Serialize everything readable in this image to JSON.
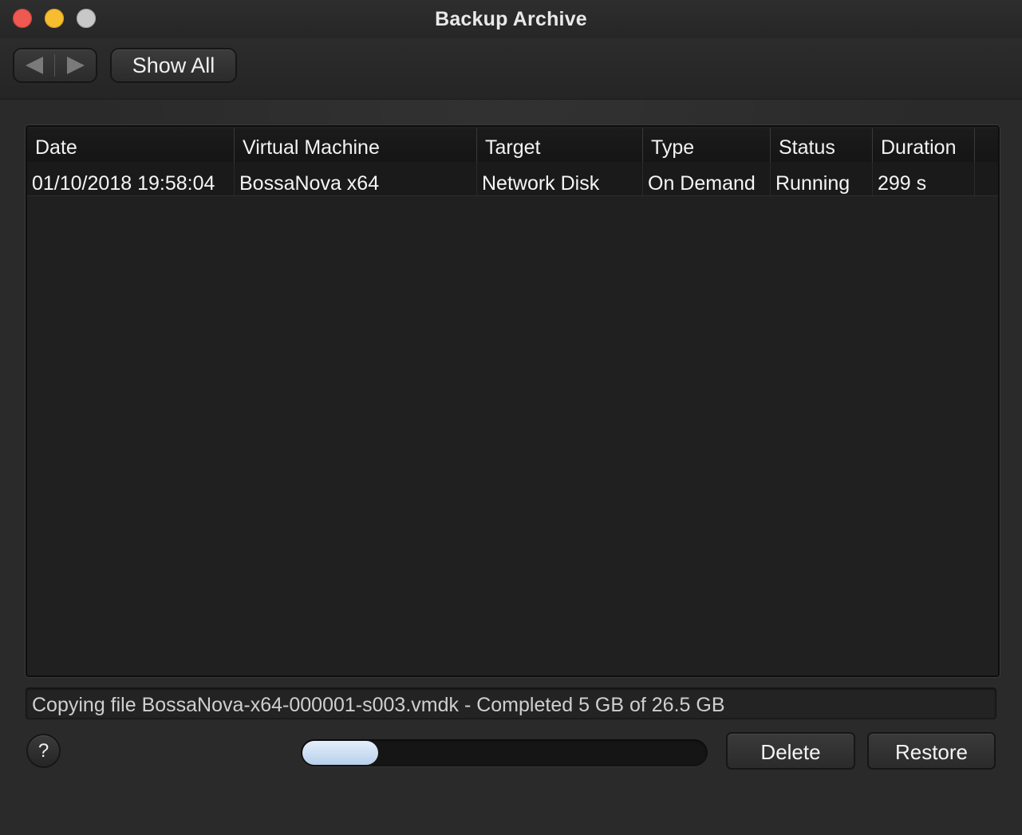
{
  "window": {
    "title": "Backup Archive"
  },
  "toolbar": {
    "back_icon": "back-arrow-icon",
    "forward_icon": "forward-arrow-icon",
    "show_all_label": "Show All"
  },
  "table": {
    "columns": [
      "Date",
      "Virtual Machine",
      "Target",
      "Type",
      "Status",
      "Duration"
    ],
    "rows": [
      {
        "date": "01/10/2018 19:58:04",
        "virtual_machine": "BossaNova x64",
        "target": "Network Disk",
        "type": "On Demand",
        "status": "Running",
        "duration": "299 s"
      }
    ]
  },
  "status": {
    "message": "Copying file BossaNova-x64-000001-s003.vmdk - Completed 5 GB of 26.5 GB"
  },
  "progress": {
    "completed_gb": 5,
    "total_gb": 26.5
  },
  "buttons": {
    "help_label": "?",
    "delete_label": "Delete",
    "restore_label": "Restore"
  },
  "colors": {
    "close": "#ee5a52",
    "minimize": "#f5bd2f",
    "zoom": "#c8c8c8",
    "progress_fill": "#c7dbf1"
  }
}
